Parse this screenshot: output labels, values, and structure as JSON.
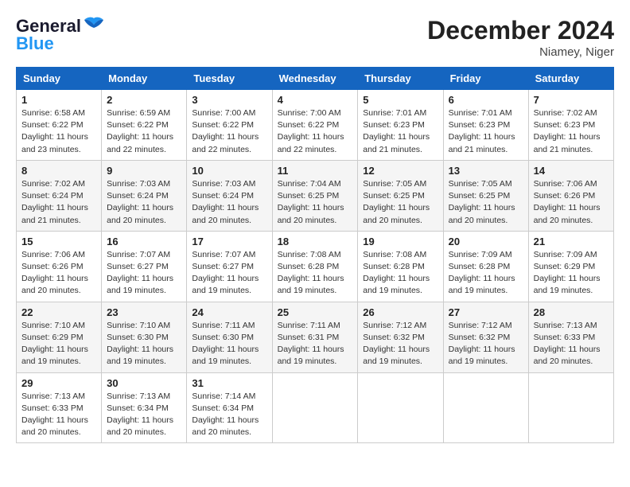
{
  "header": {
    "logo_general": "General",
    "logo_blue": "Blue",
    "month_title": "December 2024",
    "location": "Niamey, Niger"
  },
  "days_of_week": [
    "Sunday",
    "Monday",
    "Tuesday",
    "Wednesday",
    "Thursday",
    "Friday",
    "Saturday"
  ],
  "weeks": [
    [
      {
        "day": "1",
        "sunrise": "Sunrise: 6:58 AM",
        "sunset": "Sunset: 6:22 PM",
        "daylight": "Daylight: 11 hours and 23 minutes."
      },
      {
        "day": "2",
        "sunrise": "Sunrise: 6:59 AM",
        "sunset": "Sunset: 6:22 PM",
        "daylight": "Daylight: 11 hours and 22 minutes."
      },
      {
        "day": "3",
        "sunrise": "Sunrise: 7:00 AM",
        "sunset": "Sunset: 6:22 PM",
        "daylight": "Daylight: 11 hours and 22 minutes."
      },
      {
        "day": "4",
        "sunrise": "Sunrise: 7:00 AM",
        "sunset": "Sunset: 6:22 PM",
        "daylight": "Daylight: 11 hours and 22 minutes."
      },
      {
        "day": "5",
        "sunrise": "Sunrise: 7:01 AM",
        "sunset": "Sunset: 6:23 PM",
        "daylight": "Daylight: 11 hours and 21 minutes."
      },
      {
        "day": "6",
        "sunrise": "Sunrise: 7:01 AM",
        "sunset": "Sunset: 6:23 PM",
        "daylight": "Daylight: 11 hours and 21 minutes."
      },
      {
        "day": "7",
        "sunrise": "Sunrise: 7:02 AM",
        "sunset": "Sunset: 6:23 PM",
        "daylight": "Daylight: 11 hours and 21 minutes."
      }
    ],
    [
      {
        "day": "8",
        "sunrise": "Sunrise: 7:02 AM",
        "sunset": "Sunset: 6:24 PM",
        "daylight": "Daylight: 11 hours and 21 minutes."
      },
      {
        "day": "9",
        "sunrise": "Sunrise: 7:03 AM",
        "sunset": "Sunset: 6:24 PM",
        "daylight": "Daylight: 11 hours and 20 minutes."
      },
      {
        "day": "10",
        "sunrise": "Sunrise: 7:03 AM",
        "sunset": "Sunset: 6:24 PM",
        "daylight": "Daylight: 11 hours and 20 minutes."
      },
      {
        "day": "11",
        "sunrise": "Sunrise: 7:04 AM",
        "sunset": "Sunset: 6:25 PM",
        "daylight": "Daylight: 11 hours and 20 minutes."
      },
      {
        "day": "12",
        "sunrise": "Sunrise: 7:05 AM",
        "sunset": "Sunset: 6:25 PM",
        "daylight": "Daylight: 11 hours and 20 minutes."
      },
      {
        "day": "13",
        "sunrise": "Sunrise: 7:05 AM",
        "sunset": "Sunset: 6:25 PM",
        "daylight": "Daylight: 11 hours and 20 minutes."
      },
      {
        "day": "14",
        "sunrise": "Sunrise: 7:06 AM",
        "sunset": "Sunset: 6:26 PM",
        "daylight": "Daylight: 11 hours and 20 minutes."
      }
    ],
    [
      {
        "day": "15",
        "sunrise": "Sunrise: 7:06 AM",
        "sunset": "Sunset: 6:26 PM",
        "daylight": "Daylight: 11 hours and 20 minutes."
      },
      {
        "day": "16",
        "sunrise": "Sunrise: 7:07 AM",
        "sunset": "Sunset: 6:27 PM",
        "daylight": "Daylight: 11 hours and 19 minutes."
      },
      {
        "day": "17",
        "sunrise": "Sunrise: 7:07 AM",
        "sunset": "Sunset: 6:27 PM",
        "daylight": "Daylight: 11 hours and 19 minutes."
      },
      {
        "day": "18",
        "sunrise": "Sunrise: 7:08 AM",
        "sunset": "Sunset: 6:28 PM",
        "daylight": "Daylight: 11 hours and 19 minutes."
      },
      {
        "day": "19",
        "sunrise": "Sunrise: 7:08 AM",
        "sunset": "Sunset: 6:28 PM",
        "daylight": "Daylight: 11 hours and 19 minutes."
      },
      {
        "day": "20",
        "sunrise": "Sunrise: 7:09 AM",
        "sunset": "Sunset: 6:28 PM",
        "daylight": "Daylight: 11 hours and 19 minutes."
      },
      {
        "day": "21",
        "sunrise": "Sunrise: 7:09 AM",
        "sunset": "Sunset: 6:29 PM",
        "daylight": "Daylight: 11 hours and 19 minutes."
      }
    ],
    [
      {
        "day": "22",
        "sunrise": "Sunrise: 7:10 AM",
        "sunset": "Sunset: 6:29 PM",
        "daylight": "Daylight: 11 hours and 19 minutes."
      },
      {
        "day": "23",
        "sunrise": "Sunrise: 7:10 AM",
        "sunset": "Sunset: 6:30 PM",
        "daylight": "Daylight: 11 hours and 19 minutes."
      },
      {
        "day": "24",
        "sunrise": "Sunrise: 7:11 AM",
        "sunset": "Sunset: 6:30 PM",
        "daylight": "Daylight: 11 hours and 19 minutes."
      },
      {
        "day": "25",
        "sunrise": "Sunrise: 7:11 AM",
        "sunset": "Sunset: 6:31 PM",
        "daylight": "Daylight: 11 hours and 19 minutes."
      },
      {
        "day": "26",
        "sunrise": "Sunrise: 7:12 AM",
        "sunset": "Sunset: 6:32 PM",
        "daylight": "Daylight: 11 hours and 19 minutes."
      },
      {
        "day": "27",
        "sunrise": "Sunrise: 7:12 AM",
        "sunset": "Sunset: 6:32 PM",
        "daylight": "Daylight: 11 hours and 19 minutes."
      },
      {
        "day": "28",
        "sunrise": "Sunrise: 7:13 AM",
        "sunset": "Sunset: 6:33 PM",
        "daylight": "Daylight: 11 hours and 20 minutes."
      }
    ],
    [
      {
        "day": "29",
        "sunrise": "Sunrise: 7:13 AM",
        "sunset": "Sunset: 6:33 PM",
        "daylight": "Daylight: 11 hours and 20 minutes."
      },
      {
        "day": "30",
        "sunrise": "Sunrise: 7:13 AM",
        "sunset": "Sunset: 6:34 PM",
        "daylight": "Daylight: 11 hours and 20 minutes."
      },
      {
        "day": "31",
        "sunrise": "Sunrise: 7:14 AM",
        "sunset": "Sunset: 6:34 PM",
        "daylight": "Daylight: 11 hours and 20 minutes."
      },
      null,
      null,
      null,
      null
    ]
  ]
}
